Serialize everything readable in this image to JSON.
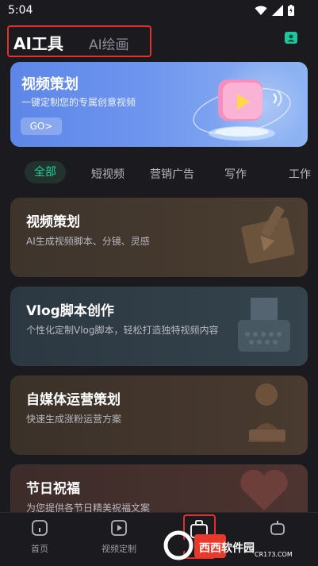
{
  "status": {
    "time": "5:04"
  },
  "header": {
    "tab_active": "AI工具",
    "tab_inactive": "AI绘画",
    "icon": "user-card-icon"
  },
  "banner": {
    "title": "视频策划",
    "subtitle": "一键定制您的专属创意视频",
    "go_label": "GO>"
  },
  "categories": {
    "active": "全部",
    "items": [
      "短视频",
      "营销广告",
      "写作",
      "工作"
    ]
  },
  "cards": [
    {
      "title": "视频策划",
      "desc": "AI生成视频脚本、分镜、灵感"
    },
    {
      "title": "Vlog脚本创作",
      "desc": "个性化定制Vlog脚本，轻松打造独特视频内容"
    },
    {
      "title": "自媒体运营策划",
      "desc": "快速生成涨粉运营方案"
    },
    {
      "title": "节日祝福",
      "desc": "为您提供各节日精美祝福文案"
    }
  ],
  "bottom_nav": {
    "items": [
      {
        "label": "首页",
        "icon": "home-icon"
      },
      {
        "label": "视频定制",
        "icon": "play-icon"
      },
      {
        "label": "",
        "icon": "briefcase-icon"
      },
      {
        "label": "",
        "icon": "robot-icon"
      }
    ]
  },
  "watermark": {
    "text": "西西软件园",
    "domain": "CR173.COM"
  },
  "colors": {
    "accent": "#19d29a",
    "highlight_box": "#e0312d",
    "background": "#1b1b1f"
  }
}
